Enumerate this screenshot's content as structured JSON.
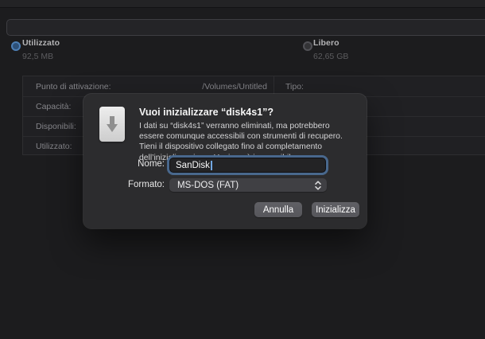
{
  "window": {
    "legend": {
      "used": {
        "label": "Utilizzato",
        "value": "92,5 MB",
        "dot_color": "#4d7fb5"
      },
      "free": {
        "label": "Libero",
        "value": "62,65 GB",
        "dot_color": "#515156"
      }
    },
    "info_table": {
      "rows": [
        {
          "label": "Punto di attivazione:",
          "value": "/Volumes/Untitled",
          "right_label": "Tipo:"
        },
        {
          "label": "Capacità:",
          "value": "",
          "right_label": ""
        },
        {
          "label": "Disponibili:",
          "value": "",
          "right_label": ""
        },
        {
          "label": "Utilizzato:",
          "value": "",
          "right_label": ""
        }
      ]
    }
  },
  "dialog": {
    "title": "Vuoi inizializzare “disk4s1”?",
    "message": "I dati su “disk4s1” verranno eliminati, ma potrebbero essere comunque accessibili con strumenti di recupero. Tieni il dispositivo collegato fino al completamento dell’inizializzazione. L’azione è irreversibile.",
    "fields": {
      "name": {
        "label": "Nome:",
        "value": "SanDisk"
      },
      "format": {
        "label": "Formato:",
        "value": "MS-DOS (FAT)"
      }
    },
    "buttons": {
      "cancel": "Annulla",
      "confirm": "Inizializza"
    }
  },
  "colors": {
    "background": "#1c1c1e",
    "dialog_background": "#2c2c2e",
    "focus_ring": "#49688d",
    "accent_used": "#4d7fb5"
  }
}
